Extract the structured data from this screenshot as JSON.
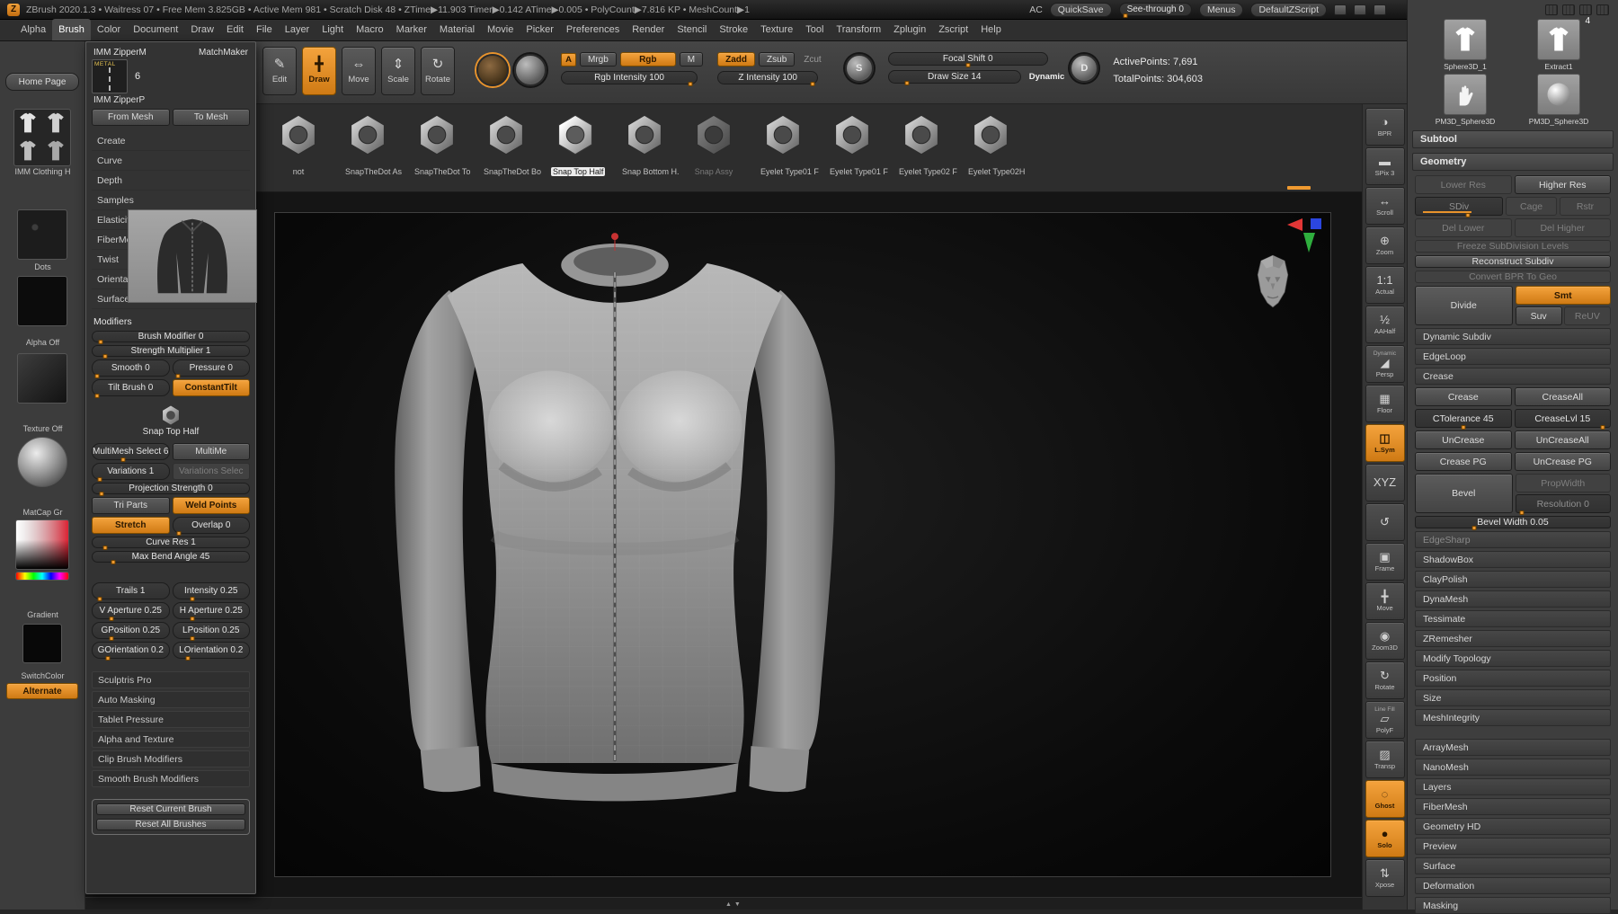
{
  "icons": {
    "edit": "✎",
    "draw": "╋",
    "move": "⇔",
    "scale": "⇕",
    "rotate": "↻"
  },
  "titlebar": {
    "logo": "Z",
    "title": "ZBrush 2020.1.3 • Waitress 07 • Free Mem 3.825GB • Active Mem 981 • Scratch Disk 48 • ZTime▶11.903 Timer▶0.142 ATime▶0.005 • PolyCount▶7.816 KP • MeshCount▶1",
    "ac": "AC",
    "quicksave": "QuickSave",
    "see_through": "See-through 0",
    "menus": "Menus",
    "zscript": "DefaultZScript"
  },
  "menubar": {
    "active": "Brush",
    "items": [
      "Alpha",
      "Brush",
      "Color",
      "Document",
      "Draw",
      "Edit",
      "File",
      "Layer",
      "Light",
      "Macro",
      "Marker",
      "Material",
      "Movie",
      "Picker",
      "Preferences",
      "Render",
      "Stencil",
      "Stroke",
      "Texture",
      "Tool",
      "Transform",
      "Zplugin",
      "Zscript",
      "Help"
    ]
  },
  "shelf": {
    "edit": "Edit",
    "draw": "Draw",
    "move": "Move",
    "scale": "Scale",
    "rotate": "Rotate",
    "a": "A",
    "mrgb": "Mrgb",
    "rgb": "Rgb",
    "m": "M",
    "zadd": "Zadd",
    "zsub": "Zsub",
    "zcut": "Zcut",
    "rgb_intensity": "Rgb Intensity 100",
    "z_intensity": "Z Intensity 100",
    "focal_shift": "Focal Shift 0",
    "draw_size": "Draw Size 14",
    "dynamic": "Dynamic",
    "sculptris": "S",
    "dynamic_d": "D",
    "active_points": "ActivePoints: 7,691",
    "total_points": "TotalPoints: 304,603"
  },
  "leftshelf": {
    "home": "Home Page",
    "imm": "IMM Clothing H",
    "dots": "Dots",
    "alpha": "Alpha Off",
    "texture": "Texture Off",
    "matcap": "MatCap Gr",
    "gradient": "Gradient",
    "switch": "SwitchColor",
    "alternate": "Alternate"
  },
  "brushstrip": {
    "items": [
      {
        "label": "not"
      },
      {
        "label": "SnapTheDot As"
      },
      {
        "label": "SnapTheDot To"
      },
      {
        "label": "SnapTheDot Bo"
      },
      {
        "label": "Snap Top Half",
        "selected": true
      },
      {
        "label": "Snap Bottom H."
      },
      {
        "label": "Snap Assy",
        "disabled": true
      },
      {
        "label": "Eyelet Type01 F"
      },
      {
        "label": "Eyelet Type01 F"
      },
      {
        "label": "Eyelet Type02 F"
      },
      {
        "label": "Eyelet Type02H"
      }
    ]
  },
  "brushmenu": {
    "thumb1": "IMM ZipperM",
    "thumb1_tag": "METAL",
    "matchmaker": "MatchMaker",
    "thumb2": "IMM ZipperP",
    "thumb2_badge": "6",
    "from_mesh": "From Mesh",
    "to_mesh": "To Mesh",
    "categories": [
      "Create",
      "Curve",
      "Depth",
      "Samples",
      "Elasticity",
      "FiberMesh",
      "Twist",
      "Orientation",
      "Surface"
    ],
    "modifiers": "Modifiers",
    "brush_modifier": "Brush Modifier 0",
    "strength_multiplier": "Strength Multiplier 1",
    "smooth": "Smooth 0",
    "pressure": "Pressure 0",
    "tilt_brush": "Tilt Brush 0",
    "constant_tilt": "ConstantTilt",
    "snap_current": "Snap Top Half",
    "multimesh_select": "MultiMesh Select 6",
    "multimesh_more": "MultiMe",
    "variations": "Variations 1",
    "variations_select": "Variations Selec",
    "projection_strength": "Projection Strength 0",
    "tri_parts": "Tri Parts",
    "weld_points": "Weld Points",
    "stretch": "Stretch",
    "overlap": "Overlap 0",
    "curve_res": "Curve Res 1",
    "max_bend": "Max Bend Angle 45",
    "trails": "Trails 1",
    "intensity": "Intensity 0.25",
    "v_aperture": "V Aperture 0.25",
    "h_aperture": "H Aperture 0.25",
    "gposition": "GPosition 0.25",
    "lposition": "LPosition 0.25",
    "gorientation": "GOrientation 0.2",
    "lorientation": "LOrientation 0.2",
    "sections": [
      "Sculptris Pro",
      "Auto Masking",
      "Tablet Pressure",
      "Alpha and Texture",
      "Clip Brush Modifiers",
      "Smooth Brush Modifiers"
    ],
    "reset_current": "Reset Current Brush",
    "reset_all": "Reset All Brushes"
  },
  "rightshelf": {
    "items": [
      {
        "glyph": "◑",
        "label": "BPR"
      },
      {
        "glyph": "▬",
        "label": "SPix 3"
      },
      {
        "glyph": "↔",
        "label": "Scroll"
      },
      {
        "glyph": "⊕",
        "label": "Zoom"
      },
      {
        "glyph": "1:1",
        "label": "Actual"
      },
      {
        "glyph": "½",
        "label": "AAHalf"
      },
      {
        "glyph": "◢",
        "label": "Persp",
        "sub": "Dynamic"
      },
      {
        "glyph": "▦",
        "label": "Floor"
      },
      {
        "glyph": "◫",
        "label": "L.Sym",
        "active": true
      },
      {
        "glyph": "XYZ",
        "label": ""
      },
      {
        "glyph": "↺",
        "label": ""
      },
      {
        "glyph": "▣",
        "label": "Frame"
      },
      {
        "glyph": "╋",
        "label": "Move"
      },
      {
        "glyph": "◉",
        "label": "Zoom3D"
      },
      {
        "glyph": "↻",
        "label": "Rotate"
      },
      {
        "glyph": "▱",
        "label": "PolyF",
        "sub": "Line Fill"
      },
      {
        "glyph": "▨",
        "label": "Transp"
      },
      {
        "glyph": "◌",
        "label": "Ghost",
        "active": true
      },
      {
        "glyph": "●",
        "label": "Solo",
        "active": true
      },
      {
        "glyph": "⇅",
        "label": "Xpose"
      }
    ]
  },
  "tooltray": {
    "tools": [
      {
        "label": "Sphere3D_1",
        "icon": "shirt"
      },
      {
        "label": "Extract1",
        "icon": "shirt",
        "badge": "4"
      },
      {
        "label": "PM3D_Sphere3D",
        "icon": "hand"
      },
      {
        "label": "PM3D_Sphere3D",
        "icon": "sphere"
      }
    ],
    "subtool": "Subtool",
    "geometry": "Geometry",
    "lower_res": "Lower Res",
    "higher_res": "Higher Res",
    "sdiv": "SDiv",
    "cage": "Cage",
    "rstr": "Rstr",
    "del_lower": "Del Lower",
    "del_higher": "Del Higher",
    "freeze": "Freeze SubDivision Levels",
    "reconstruct": "Reconstruct Subdiv",
    "convert_bpr": "Convert BPR To Geo",
    "divide": "Divide",
    "smt": "Smt",
    "suv": "Suv",
    "reuv": "ReUV",
    "dynamic_subdiv": "Dynamic Subdiv",
    "edgeloop": "EdgeLoop",
    "crease_header": "Crease",
    "crease": "Crease",
    "crease_all": "CreaseAll",
    "ctolerance": "CTolerance 45",
    "creaselvl": "CreaseLvl 15",
    "uncrease": "UnCrease",
    "uncrease_all": "UnCreaseAll",
    "crease_pg": "Crease PG",
    "uncrease_pg": "UnCrease PG",
    "bevel": "Bevel",
    "propwidth": "PropWidth",
    "resolution": "Resolution 0",
    "bevel_width": "Bevel Width 0.05",
    "edgesharp": "EdgeSharp",
    "sections1": [
      "ShadowBox",
      "ClayPolish",
      "DynaMesh",
      "Tessimate",
      "ZRemesher",
      "Modify Topology",
      "Position",
      "Size",
      "MeshIntegrity"
    ],
    "sections2": [
      "ArrayMesh",
      "NanoMesh",
      "Layers",
      "FiberMesh",
      "Geometry HD",
      "Preview",
      "Surface",
      "Deformation",
      "Masking"
    ]
  }
}
